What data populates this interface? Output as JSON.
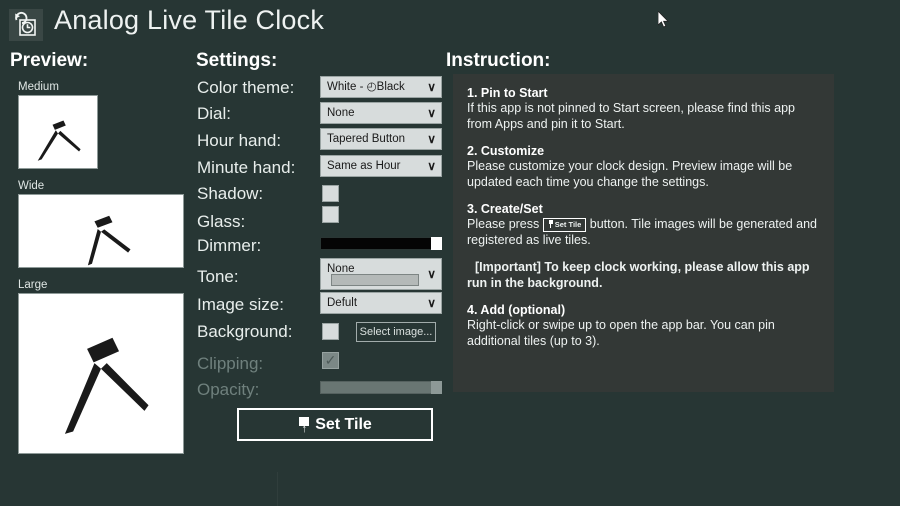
{
  "window": {
    "title": "Analog Live Tile Clock",
    "icon": "clock-refresh-icon",
    "background_color": "#273634",
    "panel_color": "#333836"
  },
  "preview": {
    "heading": "Preview:",
    "tiles": [
      {
        "label": "Medium",
        "size": "medium"
      },
      {
        "label": "Wide",
        "size": "wide"
      },
      {
        "label": "Large",
        "size": "large"
      }
    ],
    "clock": {
      "face_color": "#ffffff",
      "hand_color": "#1a1a1a",
      "hour_hand_angle_deg": 222,
      "minute_hand_angle_deg": 130
    }
  },
  "settings": {
    "heading": "Settings:",
    "rows": [
      {
        "label": "Color theme:",
        "control": "combo",
        "value": "White - ◴Black"
      },
      {
        "label": "Dial:",
        "control": "combo",
        "value": "None"
      },
      {
        "label": "Hour hand:",
        "control": "combo",
        "value": "Tapered Button"
      },
      {
        "label": "Minute hand:",
        "control": "combo",
        "value": "Same as Hour"
      },
      {
        "label": "Shadow:",
        "control": "checkbox",
        "checked": false
      },
      {
        "label": "Glass:",
        "control": "checkbox",
        "checked": false
      },
      {
        "label": "Dimmer:",
        "control": "slider",
        "value": 100
      },
      {
        "label": "Tone:",
        "control": "combo",
        "value": "None"
      },
      {
        "label": "Image size:",
        "control": "combo",
        "value": "Defult"
      },
      {
        "label": "Background:",
        "control": "checkbox+button",
        "checked": false,
        "button": "Select image..."
      },
      {
        "label": "Clipping:",
        "control": "checkbox",
        "checked": true,
        "disabled": true
      },
      {
        "label": "Opacity:",
        "control": "slider",
        "value": 100,
        "disabled": true
      }
    ],
    "labels": {
      "color_theme": "Color theme:",
      "dial": "Dial:",
      "hour_hand": "Hour hand:",
      "minute_hand": "Minute hand:",
      "shadow": "Shadow:",
      "glass": "Glass:",
      "dimmer": "Dimmer:",
      "tone": "Tone:",
      "image_size": "Image size:",
      "background": "Background:",
      "clipping": "Clipping:",
      "opacity": "Opacity:"
    },
    "values": {
      "color_theme": "White - ◴Black",
      "dial": "None",
      "hour_hand": "Tapered Button",
      "minute_hand": "Same as Hour",
      "tone": "None",
      "image_size": "Defult",
      "select_image": "Select image...",
      "clipping_check": "✓"
    },
    "set_tile_button": "Set Tile",
    "chevron": "∨"
  },
  "instruction": {
    "heading": "Instruction:",
    "steps": [
      {
        "title": "1. Pin to Start",
        "body": "If this app is not pinned to Start screen, please find this app from Apps and pin it to Start."
      },
      {
        "title": "2. Customize",
        "body": "Please customize your clock design. Preview image will be updated each time you change the settings."
      },
      {
        "title": "3. Create/Set",
        "body_before": "Please press",
        "inline_button": "Set Tile",
        "body_after": "button. Tile images will be generated and registered as live tiles."
      },
      {
        "important": "[Important] To keep clock working, please allow this app run in the background."
      },
      {
        "title": "4. Add (optional)",
        "body": "Right-click or swipe up to open the app bar. You can pin additional tiles (up to 3)."
      }
    ]
  }
}
